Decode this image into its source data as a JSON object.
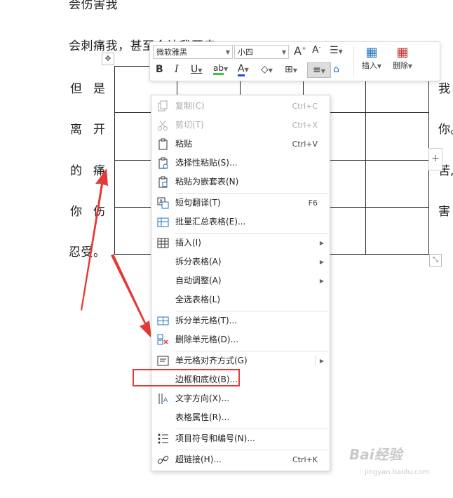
{
  "document": {
    "line_top": "会伤害我",
    "line_2": "会刺痛我，甚至会让我开走",
    "left_cells": [
      [
        "但",
        "是"
      ],
      [
        "离",
        "开"
      ],
      [
        "的",
        "痛"
      ],
      [
        "你",
        "伤"
      ]
    ],
    "line_bottom": "忍受。",
    "right_cells": [
      "我",
      "你。",
      "苦,",
      "害"
    ]
  },
  "toolbar": {
    "font_name": "微软雅黑",
    "font_size": "小四",
    "insert_label": "插入",
    "delete_label": "删除"
  },
  "menu": {
    "items": [
      {
        "label": "复制(C)",
        "shortcut": "Ctrl+C",
        "icon": "copy-icon",
        "disabled": true
      },
      {
        "label": "剪切(T)",
        "shortcut": "Ctrl+X",
        "icon": "scissors-icon",
        "disabled": true
      },
      {
        "label": "粘贴",
        "shortcut": "Ctrl+V",
        "icon": "paste-icon"
      },
      {
        "label": "选择性粘贴(S)...",
        "icon": "paste-special-icon"
      },
      {
        "label": "粘贴为嵌套表(N)",
        "icon": "paste-nested-icon"
      },
      {
        "label": "短句翻译(T)",
        "shortcut": "F6",
        "icon": "translate-icon"
      },
      {
        "label": "批量汇总表格(E)...",
        "icon": "summary-table-icon"
      },
      {
        "label": "插入(I)",
        "icon": "table-insert-icon",
        "submenu": true
      },
      {
        "label": "拆分表格(A)",
        "submenu": true
      },
      {
        "label": "自动调整(A)",
        "submenu": true
      },
      {
        "label": "全选表格(L)"
      },
      {
        "label": "拆分单元格(T)...",
        "icon": "split-cells-icon"
      },
      {
        "label": "删除单元格(D)...",
        "icon": "delete-cells-icon"
      },
      {
        "label": "单元格对齐方式(G)",
        "icon": "cell-align-icon",
        "submenu": true
      },
      {
        "label": "边框和底纹(B)..."
      },
      {
        "label": "文字方向(X)...",
        "icon": "text-direction-icon"
      },
      {
        "label": "表格属性(R)..."
      },
      {
        "label": "项目符号和编号(N)...",
        "icon": "bullet-list-icon"
      },
      {
        "label": "超链接(H)...",
        "shortcut": "Ctrl+K",
        "icon": "link-icon"
      }
    ]
  },
  "annotation": {
    "arrow_color": "#e53935",
    "highlight_color": "#e53935"
  },
  "watermark": {
    "brand": "Bai经验",
    "url": "jingyan.baidu.com"
  }
}
